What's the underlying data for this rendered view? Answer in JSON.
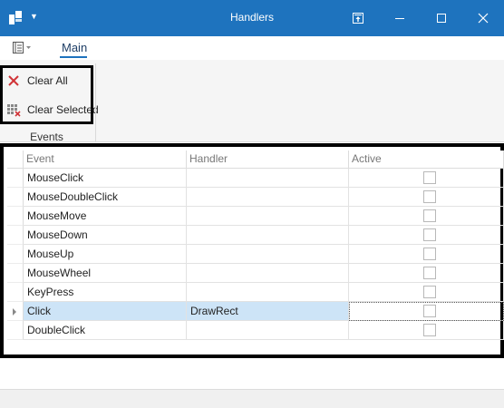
{
  "window": {
    "title": "Handlers",
    "accent_color": "#1e73be"
  },
  "ribbon": {
    "tabs": [
      {
        "label": "Main",
        "selected": true
      }
    ],
    "group": {
      "caption": "Events",
      "buttons": [
        {
          "label": "Clear All",
          "icon": "red-x-icon"
        },
        {
          "label": "Clear Selected",
          "icon": "clear-selected-grid-icon"
        }
      ]
    }
  },
  "grid": {
    "columns": [
      "Event",
      "Handler",
      "Active"
    ],
    "rows": [
      {
        "event": "MouseClick",
        "handler": "",
        "active": false
      },
      {
        "event": "MouseDoubleClick",
        "handler": "",
        "active": false
      },
      {
        "event": "MouseMove",
        "handler": "",
        "active": false
      },
      {
        "event": "MouseDown",
        "handler": "",
        "active": false
      },
      {
        "event": "MouseUp",
        "handler": "",
        "active": false
      },
      {
        "event": "MouseWheel",
        "handler": "",
        "active": false
      },
      {
        "event": "KeyPress",
        "handler": "",
        "active": false
      },
      {
        "event": "Click",
        "handler": "DrawRect",
        "active": false,
        "selected": true
      },
      {
        "event": "DoubleClick",
        "handler": "",
        "active": false
      }
    ],
    "selection_color": "#cde4f7"
  }
}
